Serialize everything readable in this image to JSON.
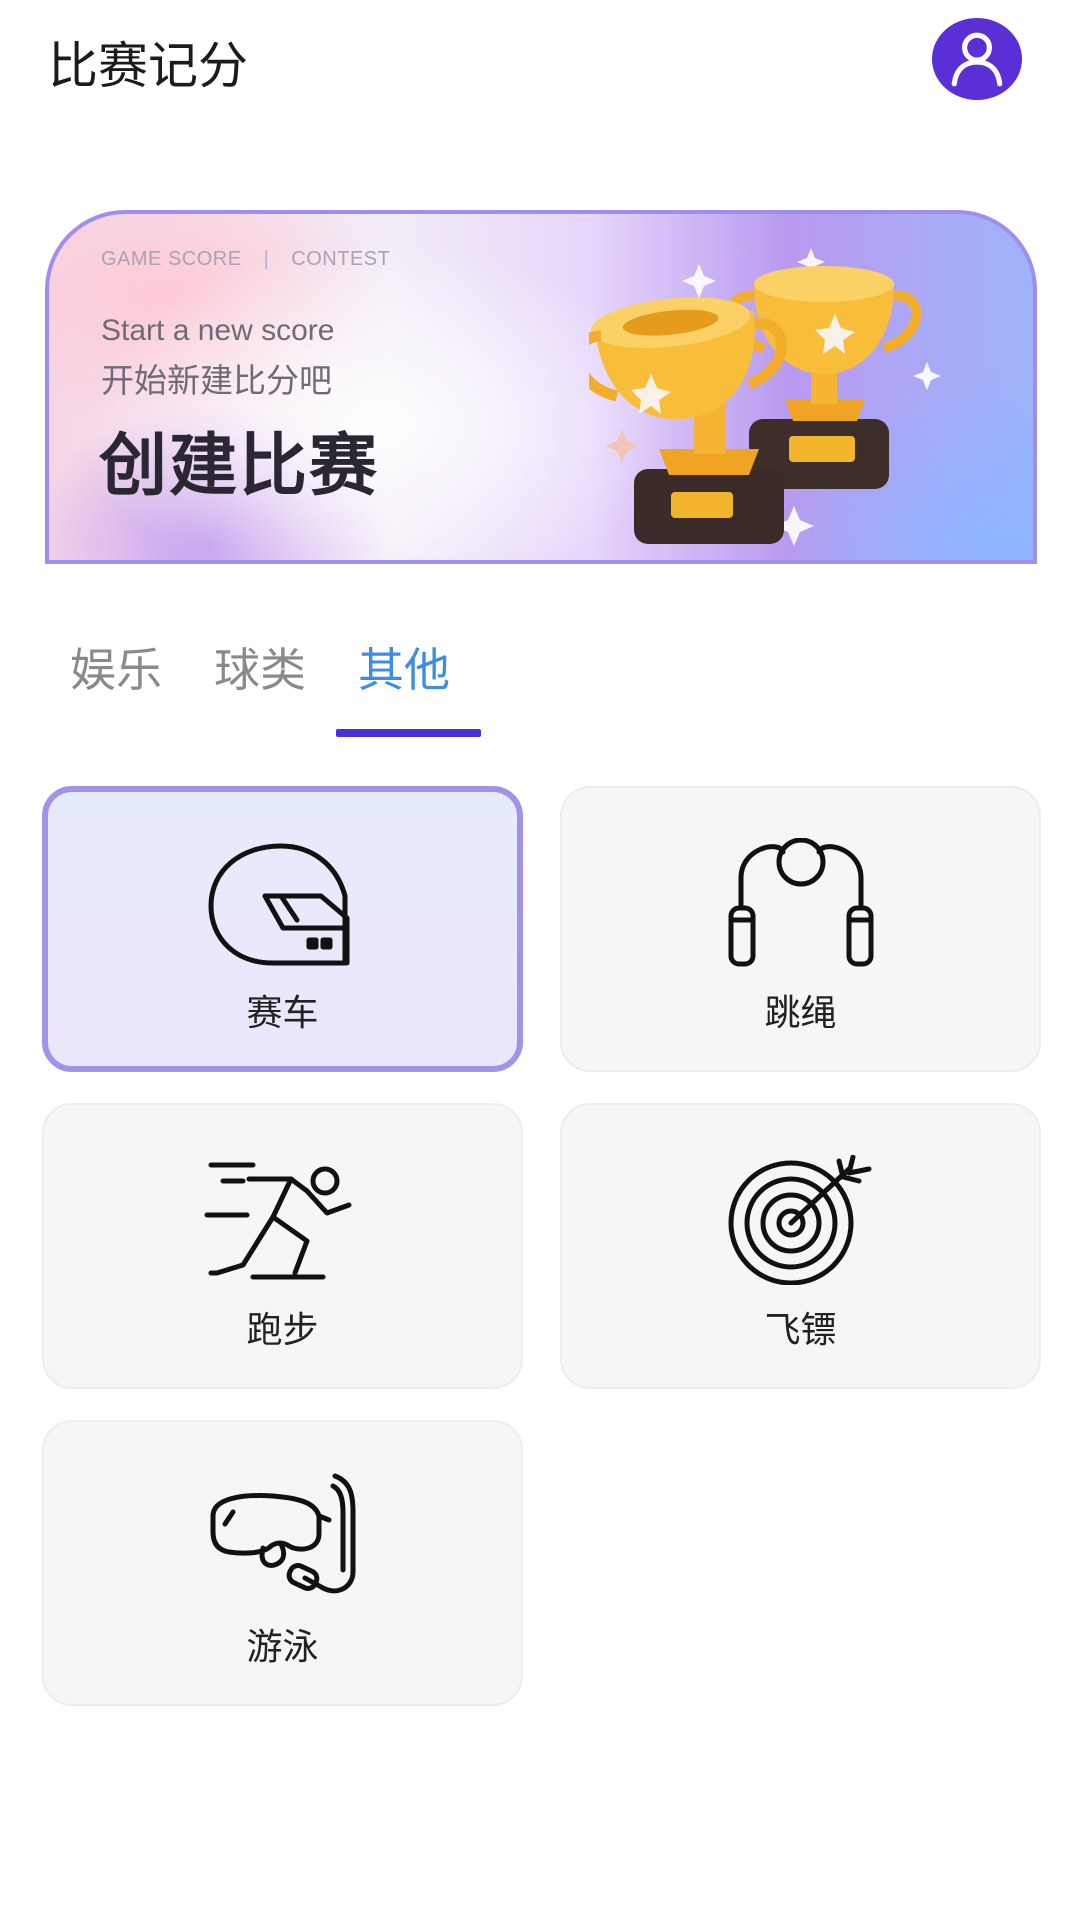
{
  "header": {
    "title": "比赛记分",
    "avatar_icon": "user-icon"
  },
  "banner": {
    "tagline_left": "GAME SCORE",
    "tagline_sep": "|",
    "tagline_right": "CONTEST",
    "subtitle_en": "Start a new score",
    "subtitle_cn": "开始新建比分吧",
    "cta": "创建比赛",
    "illustration": "trophy-icon"
  },
  "tabs": [
    {
      "label": "娱乐",
      "active": false
    },
    {
      "label": "球类",
      "active": false
    },
    {
      "label": "其他",
      "active": true
    }
  ],
  "sports": [
    {
      "label": "赛车",
      "icon": "racing-helmet-icon",
      "selected": true
    },
    {
      "label": "跳绳",
      "icon": "jump-rope-icon",
      "selected": false
    },
    {
      "label": "跑步",
      "icon": "runner-icon",
      "selected": false
    },
    {
      "label": "飞镖",
      "icon": "dartboard-icon",
      "selected": false
    },
    {
      "label": "游泳",
      "icon": "diving-mask-icon",
      "selected": false
    }
  ],
  "colors": {
    "accent": "#4a30d8",
    "active_tab_text": "#3d8de0",
    "selected_border": "#a392ea",
    "avatar_bg": "#5b2fd6"
  }
}
